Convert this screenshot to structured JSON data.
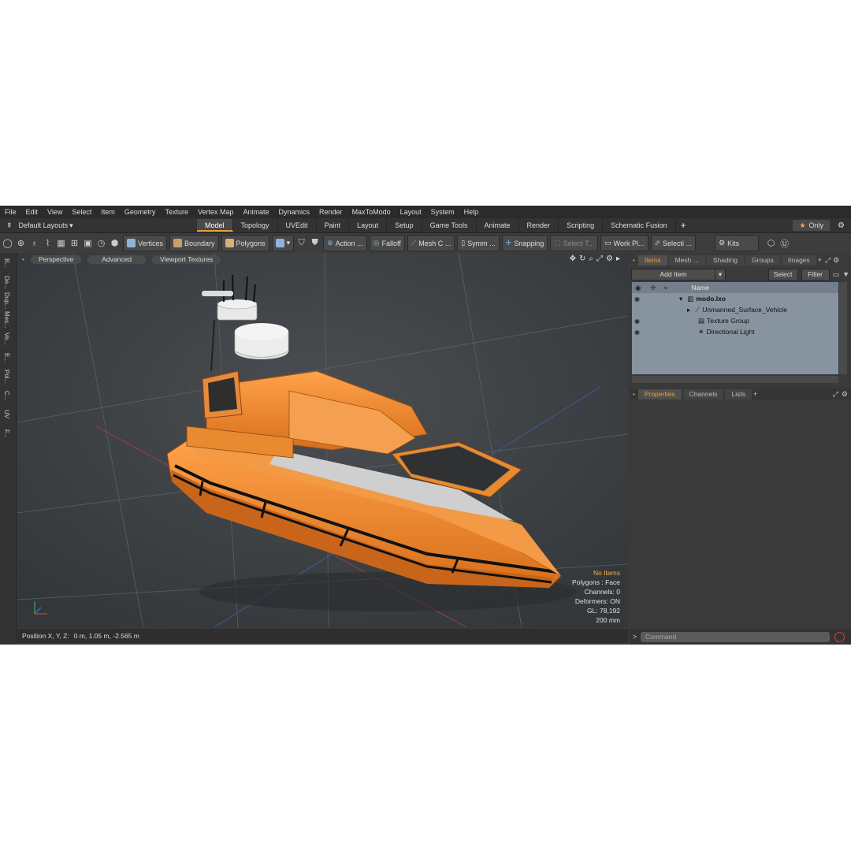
{
  "menubar": [
    "File",
    "Edit",
    "View",
    "Select",
    "Item",
    "Geometry",
    "Texture",
    "Vertex Map",
    "Animate",
    "Dynamics",
    "Render",
    "MaxToModo",
    "Layout",
    "System",
    "Help"
  ],
  "layouts_label": "Default Layouts",
  "tabs": [
    "Model",
    "Topology",
    "UVEdit",
    "Paint",
    "Layout",
    "Setup",
    "Game Tools",
    "Animate",
    "Render",
    "Scripting",
    "Schematic Fusion"
  ],
  "active_tab": "Model",
  "only_label": "Only",
  "toolbar": {
    "vertices": "Vertices",
    "boundary": "Boundary",
    "polygons": "Polygons",
    "action": "Action ...",
    "falloff": "Falloff",
    "mesh_c": "Mesh C ...",
    "symm": "Symm ...",
    "snapping": "Snapping",
    "select_t": "Select T...",
    "work_pl": "Work Pl...",
    "selecti": "Selecti ...",
    "kits": "Kits"
  },
  "left_strip": [
    "B...",
    "De...",
    "Dup...",
    "Mes...",
    "Ve...",
    "E...",
    "Pol...",
    "C...",
    "UV",
    "F..."
  ],
  "viewport": {
    "perspective": "Perspective",
    "advanced": "Advanced",
    "textures": "Viewport Textures",
    "stats": {
      "no_items": "No Items",
      "polygons": "Polygons : Face",
      "channels": "Channels: 0",
      "deformers": "Deformers: ON",
      "gl": "GL: 78,192",
      "scale": "200 mm"
    }
  },
  "status": {
    "position_label": "Position X, Y, Z:",
    "position_value": "0 m, 1.05 m, -2.565 m"
  },
  "right_tabs": [
    "Items",
    "Mesh ...",
    "Shading",
    "Groups",
    "Images"
  ],
  "items_bar": {
    "add_item": "Add Item",
    "select": "Select",
    "filter": "Filter"
  },
  "tree": {
    "name_header": "Name",
    "rows": [
      "modo.lxo",
      "Unmanned_Surface_Vehicle",
      "Texture Group",
      "Directional Light"
    ]
  },
  "props_tabs": [
    "Properties",
    "Channels",
    "Lists"
  ],
  "command_placeholder": "Command",
  "colors": {
    "accent": "#e8a033",
    "hull": "#f08c2e",
    "viewport_bg": "#414141"
  }
}
